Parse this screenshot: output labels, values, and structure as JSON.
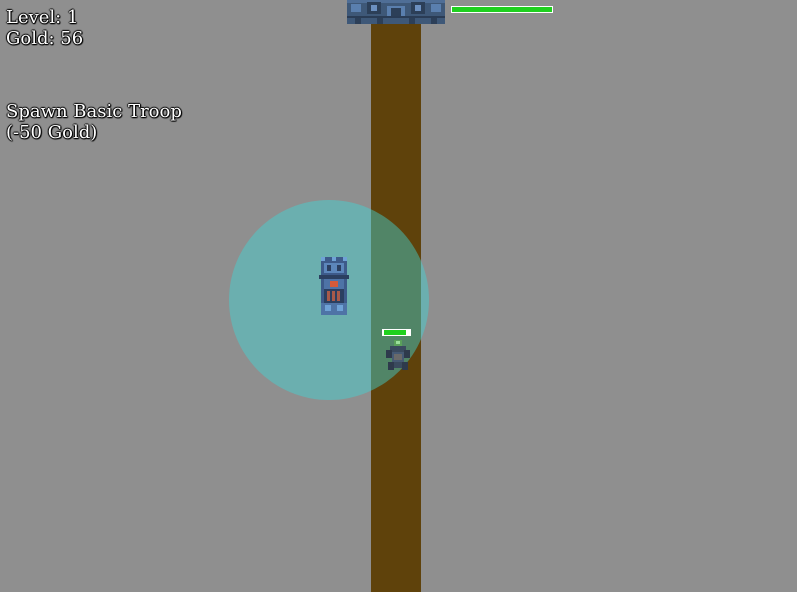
{
  "hud": {
    "level_text": "Level: 1",
    "gold_text": "Gold: 56"
  },
  "spawn_button": {
    "line1": "Spawn Basic Troop",
    "line2": "(-50 Gold)"
  },
  "base": {
    "health_fraction": 1.0
  },
  "enemy": {
    "health_fraction": 0.86
  },
  "colors": {
    "background": "#8f8f8f",
    "path": "#5f420b",
    "range": "#40d6d6",
    "health": "#1fd01f",
    "sprite_blue": "#3d5a8a"
  }
}
